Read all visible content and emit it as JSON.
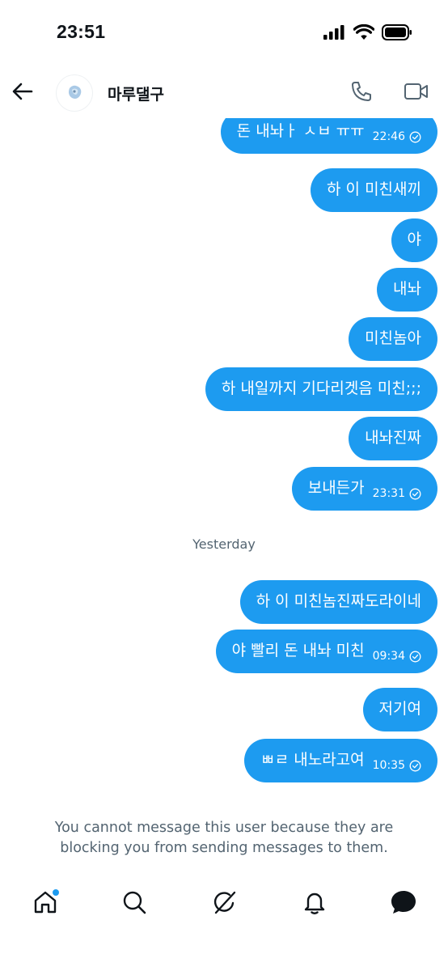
{
  "status_bar": {
    "time": "23:51"
  },
  "header": {
    "contact_name": "마루댈구",
    "back_icon": "arrow-left-icon",
    "call_icon": "phone-icon",
    "video_icon": "video-camera-icon"
  },
  "messages": [
    {
      "text": "돈 내놔ㅏ ㅅㅂ ㅠㅠ",
      "time": "22:46",
      "read": true
    },
    {
      "text": "하 이 미친새끼"
    },
    {
      "text": "야"
    },
    {
      "text": "내놔"
    },
    {
      "text": "미친놈아"
    },
    {
      "text": "하 내일까지 기다리겟음 미친;;;"
    },
    {
      "text": "내놔진짜"
    },
    {
      "text": "보내든가",
      "time": "23:31",
      "read": true
    },
    {
      "date_divider": "Yesterday"
    },
    {
      "text": "하 이 미친놈진짜도라이네"
    },
    {
      "text": "야 빨리 돈 내놔 미친",
      "time": "09:34",
      "read": true
    },
    {
      "text": "저기여"
    },
    {
      "text": "ㅃㄹ 내노라고여",
      "time": "10:35",
      "read": true
    }
  ],
  "blocked_notice": "You cannot message this user because they are blocking you from sending messages to them.",
  "bottom_nav": [
    {
      "name": "home",
      "icon": "home-icon",
      "has_dot": true
    },
    {
      "name": "search",
      "icon": "search-icon"
    },
    {
      "name": "grok",
      "icon": "grok-icon"
    },
    {
      "name": "notifications",
      "icon": "bell-icon"
    },
    {
      "name": "messages",
      "icon": "message-icon"
    }
  ],
  "colors": {
    "accent": "#1d9bf0",
    "text_secondary": "#536471",
    "text_primary": "#0f1419"
  }
}
